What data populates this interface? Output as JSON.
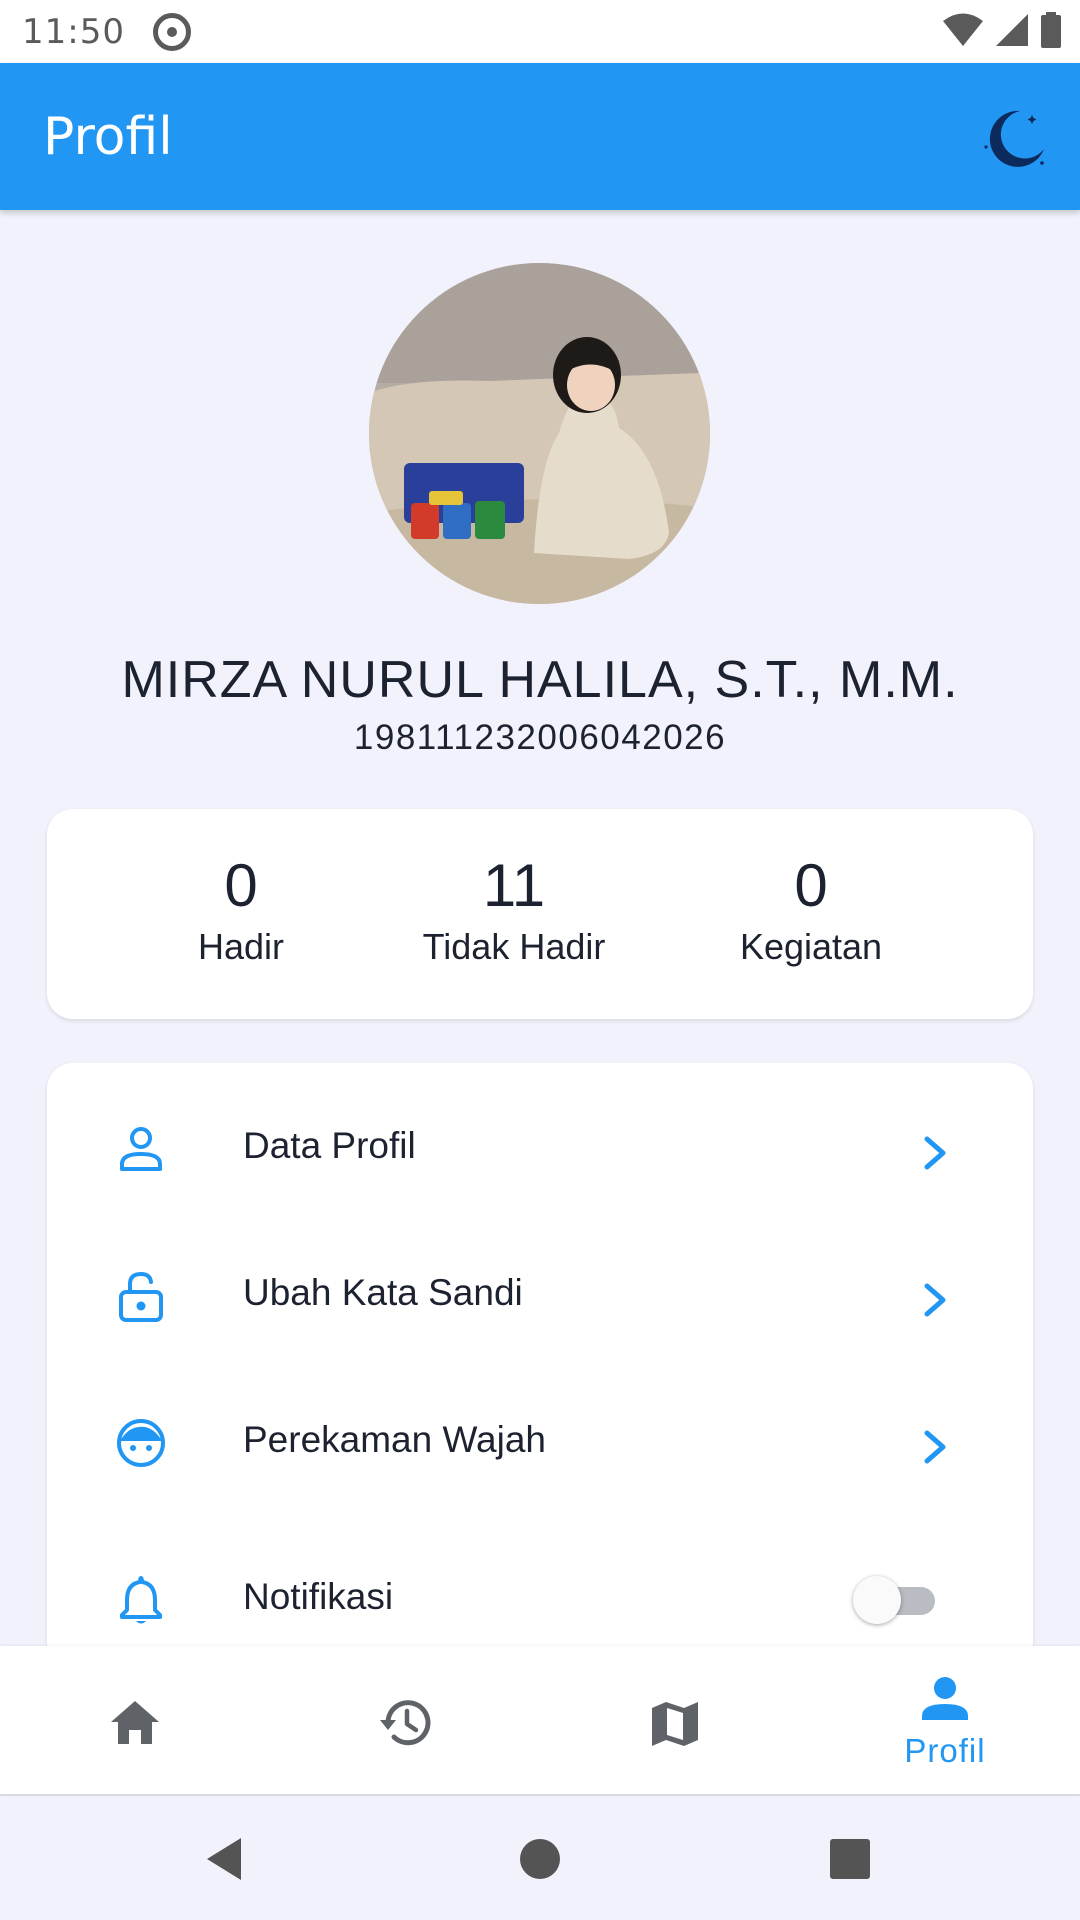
{
  "status_bar": {
    "time": "11:50"
  },
  "app_bar": {
    "title": "Profil"
  },
  "profile": {
    "name": "MIRZA NURUL HALILA, S.T., M.M.",
    "nip": "198111232006042026"
  },
  "stats": [
    {
      "value": "0",
      "label": "Hadir"
    },
    {
      "value": "11",
      "label": "Tidak Hadir"
    },
    {
      "value": "0",
      "label": "Kegiatan"
    }
  ],
  "menu": {
    "items": [
      {
        "label": "Data Profil",
        "icon": "person-icon"
      },
      {
        "label": "Ubah Kata Sandi",
        "icon": "lock-icon"
      },
      {
        "label": "Perekaman Wajah",
        "icon": "face-icon"
      },
      {
        "label": "Notifikasi",
        "icon": "bell-icon",
        "toggle_on": false
      }
    ]
  },
  "bottom_nav": {
    "items": [
      {
        "icon": "home-icon"
      },
      {
        "icon": "history-icon"
      },
      {
        "icon": "map-icon"
      },
      {
        "icon": "person-icon",
        "label": "Profil",
        "active": true
      }
    ]
  },
  "colors": {
    "primary": "#2196f3",
    "background": "#f1f2fb",
    "text": "#1d2230",
    "inactive_icon": "#5f6368",
    "moon": "#0d2a5c"
  }
}
